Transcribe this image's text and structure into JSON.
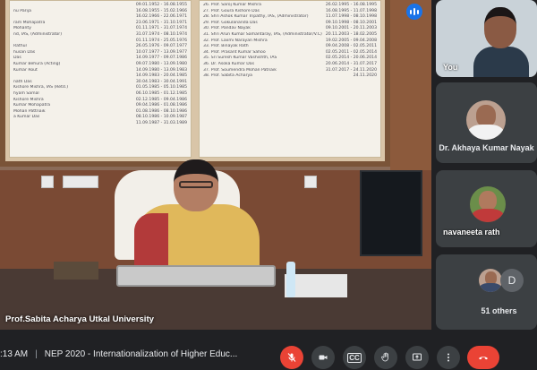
{
  "stage": {
    "speaker_label": "Prof.Sabita Acharya Utkal University",
    "left_panel_rows": [
      {
        "name": "",
        "date": "09.01.1952 - 16.08.1955"
      },
      {
        "name": "nu Parija",
        "date": "16.08.1955 - 15.02.1966"
      },
      {
        "name": "",
        "date": "16.02.1966 - 22.06.1971"
      },
      {
        "name": "ram Mohapatra",
        "date": "23.06.1971 - 31.10.1971"
      },
      {
        "name": "Mohanty",
        "date": "01.11.1971 - 31.07.1974"
      },
      {
        "name": "nd, IAS, (Administrator)",
        "date": "31.07.1974 - 08.10.1974"
      },
      {
        "name": "",
        "date": "01.11.1974 - 25.05.1976"
      },
      {
        "name": "Rathur",
        "date": "26.05.1976 - 09.07.1977"
      },
      {
        "name": "husan Das",
        "date": "10.07.1977 - 13.09.1977"
      },
      {
        "name": "Das",
        "date": "14.09.1977 - 09.07.1986"
      },
      {
        "name": "Kumar Behura (Acting)",
        "date": "09.07.1980 - 13.09.1980"
      },
      {
        "name": "Kumar Rout",
        "date": "14.09.1980 - 13.09.1983"
      },
      {
        "name": "",
        "date": "14.09.1983 - 20.04.1985"
      },
      {
        "name": "nath Das",
        "date": "30.04.1983 - 30.04.1991"
      },
      {
        "name": "Kishore Mishra, IAS (Retd.)",
        "date": "01.05.1985 - 05.10.1985"
      },
      {
        "name": "hyam Samal",
        "date": "06.10.1985 - 01.12.1985"
      },
      {
        "name": "Kishore Mishra",
        "date": "02.12.1985 - 09.04.1986"
      },
      {
        "name": "Kumar Mohapatra",
        "date": "09.04.1986 - 01.08.1986"
      },
      {
        "name": "Mohan Pattnaik",
        "date": "01.08.1986 - 08.10.1986"
      },
      {
        "name": "a Kumar Das",
        "date": "08.10.1986 - 10.09.1987"
      },
      {
        "name": "",
        "date": "11.09.1987 - 31.03.1989"
      }
    ],
    "right_panel_rows": [
      {
        "name": "26. Prof. Saroj Kumar Mishra",
        "date": "26.02.1995 - 16.08.1995"
      },
      {
        "name": "27. Prof. Goura Kishore Das",
        "date": "16.08.1995 - 11.07.1998"
      },
      {
        "name": "28. Shri Ashok Kumar Tripathy, IAS, (Administrator)",
        "date": "11.07.1998 - 08.10.1998"
      },
      {
        "name": "29. Prof. Gokulananda Das",
        "date": "09.10.1998 - 08.10.2001"
      },
      {
        "name": "30. Prof. Pandav Nayak",
        "date": "09.10.2001 - 20.11.2003"
      },
      {
        "name": "31. Shri Arun Kumar Samantaray, IAS, (Administrator/V.C)",
        "date": "20.11.2003 - 18.02.2005"
      },
      {
        "name": "32. Prof. Laxmi Narayan Mishra",
        "date": "19.02.2005 - 09.04.2008"
      },
      {
        "name": "33. Prof. Binayak Rath",
        "date": "09.04.2008 - 02.05.2011"
      },
      {
        "name": "34. Prof. Prasant Kumar Sahoo",
        "date": "02.05.2011 - 02.05.2014"
      },
      {
        "name": "35. Sri Suresh Kumar Vashishth, IAS",
        "date": "02.05.2014 - 20.06.2014"
      },
      {
        "name": "36. Dr. Asoka Kumar Das",
        "date": "20.06.2014 - 31.07.2017"
      },
      {
        "name": "37. Prof. Soumendra Mohan Patnaik",
        "date": "31.07.2017 - 24.11.2020"
      },
      {
        "name": "38. Prof. Sabita Acharya",
        "date": "24.11.2020"
      }
    ]
  },
  "participants": {
    "self_label": "You",
    "tile1_name": "Dr. Akhaya Kumar Nayak",
    "tile2_name": "navaneeta rath",
    "others_avatar_letter": "D",
    "others_label": "51 others"
  },
  "bottombar": {
    "time": ":13 AM",
    "separator": "|",
    "meeting_title": "NEP 2020 - Internationalization of Higher Educ..."
  },
  "controls": {
    "mic": "mic-off-icon",
    "camera": "camera-icon",
    "captions": "CC",
    "raise_hand": "hand-icon",
    "present": "present-icon",
    "more": "more-vert-icon",
    "end_call": "end-call-icon"
  },
  "colors": {
    "background": "#202124",
    "tile": "#3c4043",
    "danger": "#ea4335",
    "active_speaker": "#1a73e8"
  }
}
